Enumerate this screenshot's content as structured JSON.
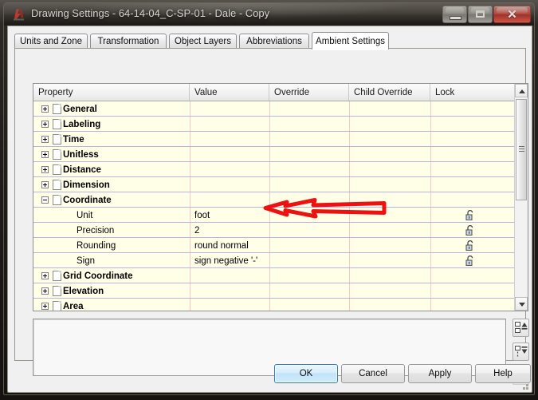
{
  "window": {
    "title": "Drawing Settings - 64-14-04_C-SP-01 - Dale - Copy",
    "app_icon": "autocad-app-icon",
    "controls": {
      "minimize": "Minimize",
      "maximize": "Maximize",
      "close": "Close",
      "close_glyph": "✕"
    }
  },
  "tabs": [
    {
      "label": "Units and Zone",
      "active": false
    },
    {
      "label": "Transformation",
      "active": false
    },
    {
      "label": "Object Layers",
      "active": false
    },
    {
      "label": "Abbreviations",
      "active": false
    },
    {
      "label": "Ambient Settings",
      "active": true
    }
  ],
  "grid": {
    "columns": [
      "Property",
      "Value",
      "Override",
      "Child Override",
      "Lock"
    ],
    "rows": [
      {
        "label": "General",
        "type": "category",
        "expander": "plus",
        "value": "",
        "lock": false
      },
      {
        "label": "Labeling",
        "type": "category",
        "expander": "plus",
        "value": "",
        "lock": false
      },
      {
        "label": "Time",
        "type": "category",
        "expander": "plus",
        "value": "",
        "lock": false
      },
      {
        "label": "Unitless",
        "type": "category",
        "expander": "plus",
        "value": "",
        "lock": false
      },
      {
        "label": "Distance",
        "type": "category",
        "expander": "plus",
        "value": "",
        "lock": false
      },
      {
        "label": "Dimension",
        "type": "category",
        "expander": "plus",
        "value": "",
        "lock": false
      },
      {
        "label": "Coordinate",
        "type": "category",
        "expander": "minus",
        "value": "",
        "lock": false
      },
      {
        "label": "Unit",
        "type": "item",
        "expander": "none",
        "value": "foot",
        "lock": true
      },
      {
        "label": "Precision",
        "type": "item",
        "expander": "none",
        "value": "2",
        "lock": true
      },
      {
        "label": "Rounding",
        "type": "item",
        "expander": "none",
        "value": "round normal",
        "lock": true
      },
      {
        "label": "Sign",
        "type": "item",
        "expander": "none",
        "value": "sign negative '-'",
        "lock": true
      },
      {
        "label": "Grid Coordinate",
        "type": "category",
        "expander": "plus",
        "value": "",
        "lock": false
      },
      {
        "label": "Elevation",
        "type": "category",
        "expander": "plus",
        "value": "",
        "lock": false
      },
      {
        "label": "Area",
        "type": "category",
        "expander": "plus",
        "value": "",
        "lock": false
      }
    ],
    "scrollbar": {
      "up": "Scroll up",
      "down": "Scroll down",
      "thumb": "Scroll thumb"
    },
    "colors": {
      "cell_background": "#ffffe8",
      "row_line": "#b9b5e0",
      "column_line": "#f3c9cb"
    }
  },
  "side_buttons": [
    {
      "name": "move-up-button",
      "enabled": true
    },
    {
      "name": "move-down-button",
      "enabled": true
    },
    {
      "name": "apply-to-all-button",
      "enabled": false
    }
  ],
  "preview": {
    "text": ""
  },
  "footer": {
    "ok": "OK",
    "cancel": "Cancel",
    "apply": "Apply",
    "help": "Help"
  },
  "annotation": {
    "kind": "arrow-left",
    "color": "#ee1111",
    "target_row": "Precision"
  }
}
